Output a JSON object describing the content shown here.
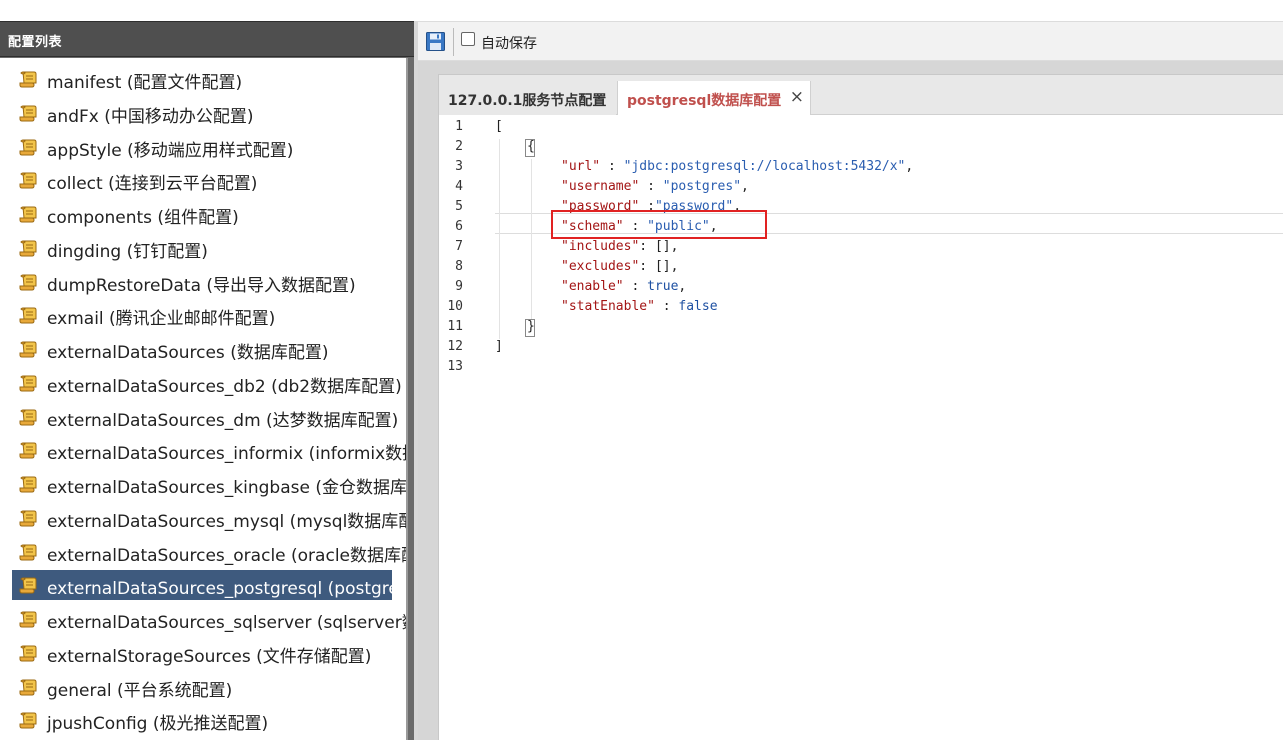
{
  "sidebar": {
    "title": "配置列表",
    "items": [
      {
        "label": "manifest (配置文件配置)"
      },
      {
        "label": "andFx (中国移动办公配置)"
      },
      {
        "label": "appStyle (移动端应用样式配置)"
      },
      {
        "label": "collect (连接到云平台配置)"
      },
      {
        "label": "components (组件配置)"
      },
      {
        "label": "dingding (钉钉配置)"
      },
      {
        "label": "dumpRestoreData (导出导入数据配置)"
      },
      {
        "label": "exmail (腾讯企业邮邮件配置)"
      },
      {
        "label": "externalDataSources (数据库配置)"
      },
      {
        "label": "externalDataSources_db2 (db2数据库配置)"
      },
      {
        "label": "externalDataSources_dm (达梦数据库配置)"
      },
      {
        "label": "externalDataSources_informix (informix数据库配置)"
      },
      {
        "label": "externalDataSources_kingbase (金仓数据库配置)"
      },
      {
        "label": "externalDataSources_mysql (mysql数据库配置)"
      },
      {
        "label": "externalDataSources_oracle (oracle数据库配置)"
      },
      {
        "label": "externalDataSources_postgresql (postgresql数据库配置)",
        "selected": true
      },
      {
        "label": "externalDataSources_sqlserver (sqlserver数据库配置)"
      },
      {
        "label": "externalStorageSources (文件存储配置)"
      },
      {
        "label": "general (平台系统配置)"
      },
      {
        "label": "jpushConfig (极光推送配置)"
      }
    ]
  },
  "toolbar": {
    "save_icon": "save-icon",
    "autosave_label": "自动保存",
    "autosave_checked": false
  },
  "tabs": [
    {
      "label": "127.0.0.1服务节点配置",
      "active": false
    },
    {
      "label": "postgresql数据库配置",
      "active": true,
      "close": "×"
    }
  ],
  "editor": {
    "line_numbers": [
      "1",
      "2",
      "3",
      "4",
      "5",
      "6",
      "7",
      "8",
      "9",
      "10",
      "11",
      "12",
      "13"
    ],
    "lines": {
      "l1": "[",
      "l2": "{",
      "l3_key": "\"url\"",
      "l3_sep": " : ",
      "l3_val": "\"jdbc:postgresql://localhost:5432/x\"",
      "l3_end": ",",
      "l4_key": "\"username\"",
      "l4_sep": " : ",
      "l4_val": "\"postgres\"",
      "l4_end": ",",
      "l5_key": "\"password\"",
      "l5_sep": " :",
      "l5_val": "\"password\"",
      "l5_end": ",",
      "l6_key": "\"schema\"",
      "l6_sep": " : ",
      "l6_val": "\"public\"",
      "l6_end": ",",
      "l7_key": "\"includes\"",
      "l7_sep": ": ",
      "l7_val": "[]",
      "l7_end": ",",
      "l8_key": "\"excludes\"",
      "l8_sep": ": ",
      "l8_val": "[]",
      "l8_end": ",",
      "l9_key": "\"enable\"",
      "l9_sep": " : ",
      "l9_val": "true",
      "l9_end": ",",
      "l10_key": "\"statEnable\"",
      "l10_sep": " : ",
      "l10_val": "false",
      "l10_end": "",
      "l11": "}",
      "l12": "]"
    },
    "highlight_color": "#e12222"
  },
  "colors": {
    "selected_bg": "#3e5a7e",
    "tab_active_text": "#c0504d",
    "json_key": "#a31515",
    "json_value": "#2a5db0"
  }
}
